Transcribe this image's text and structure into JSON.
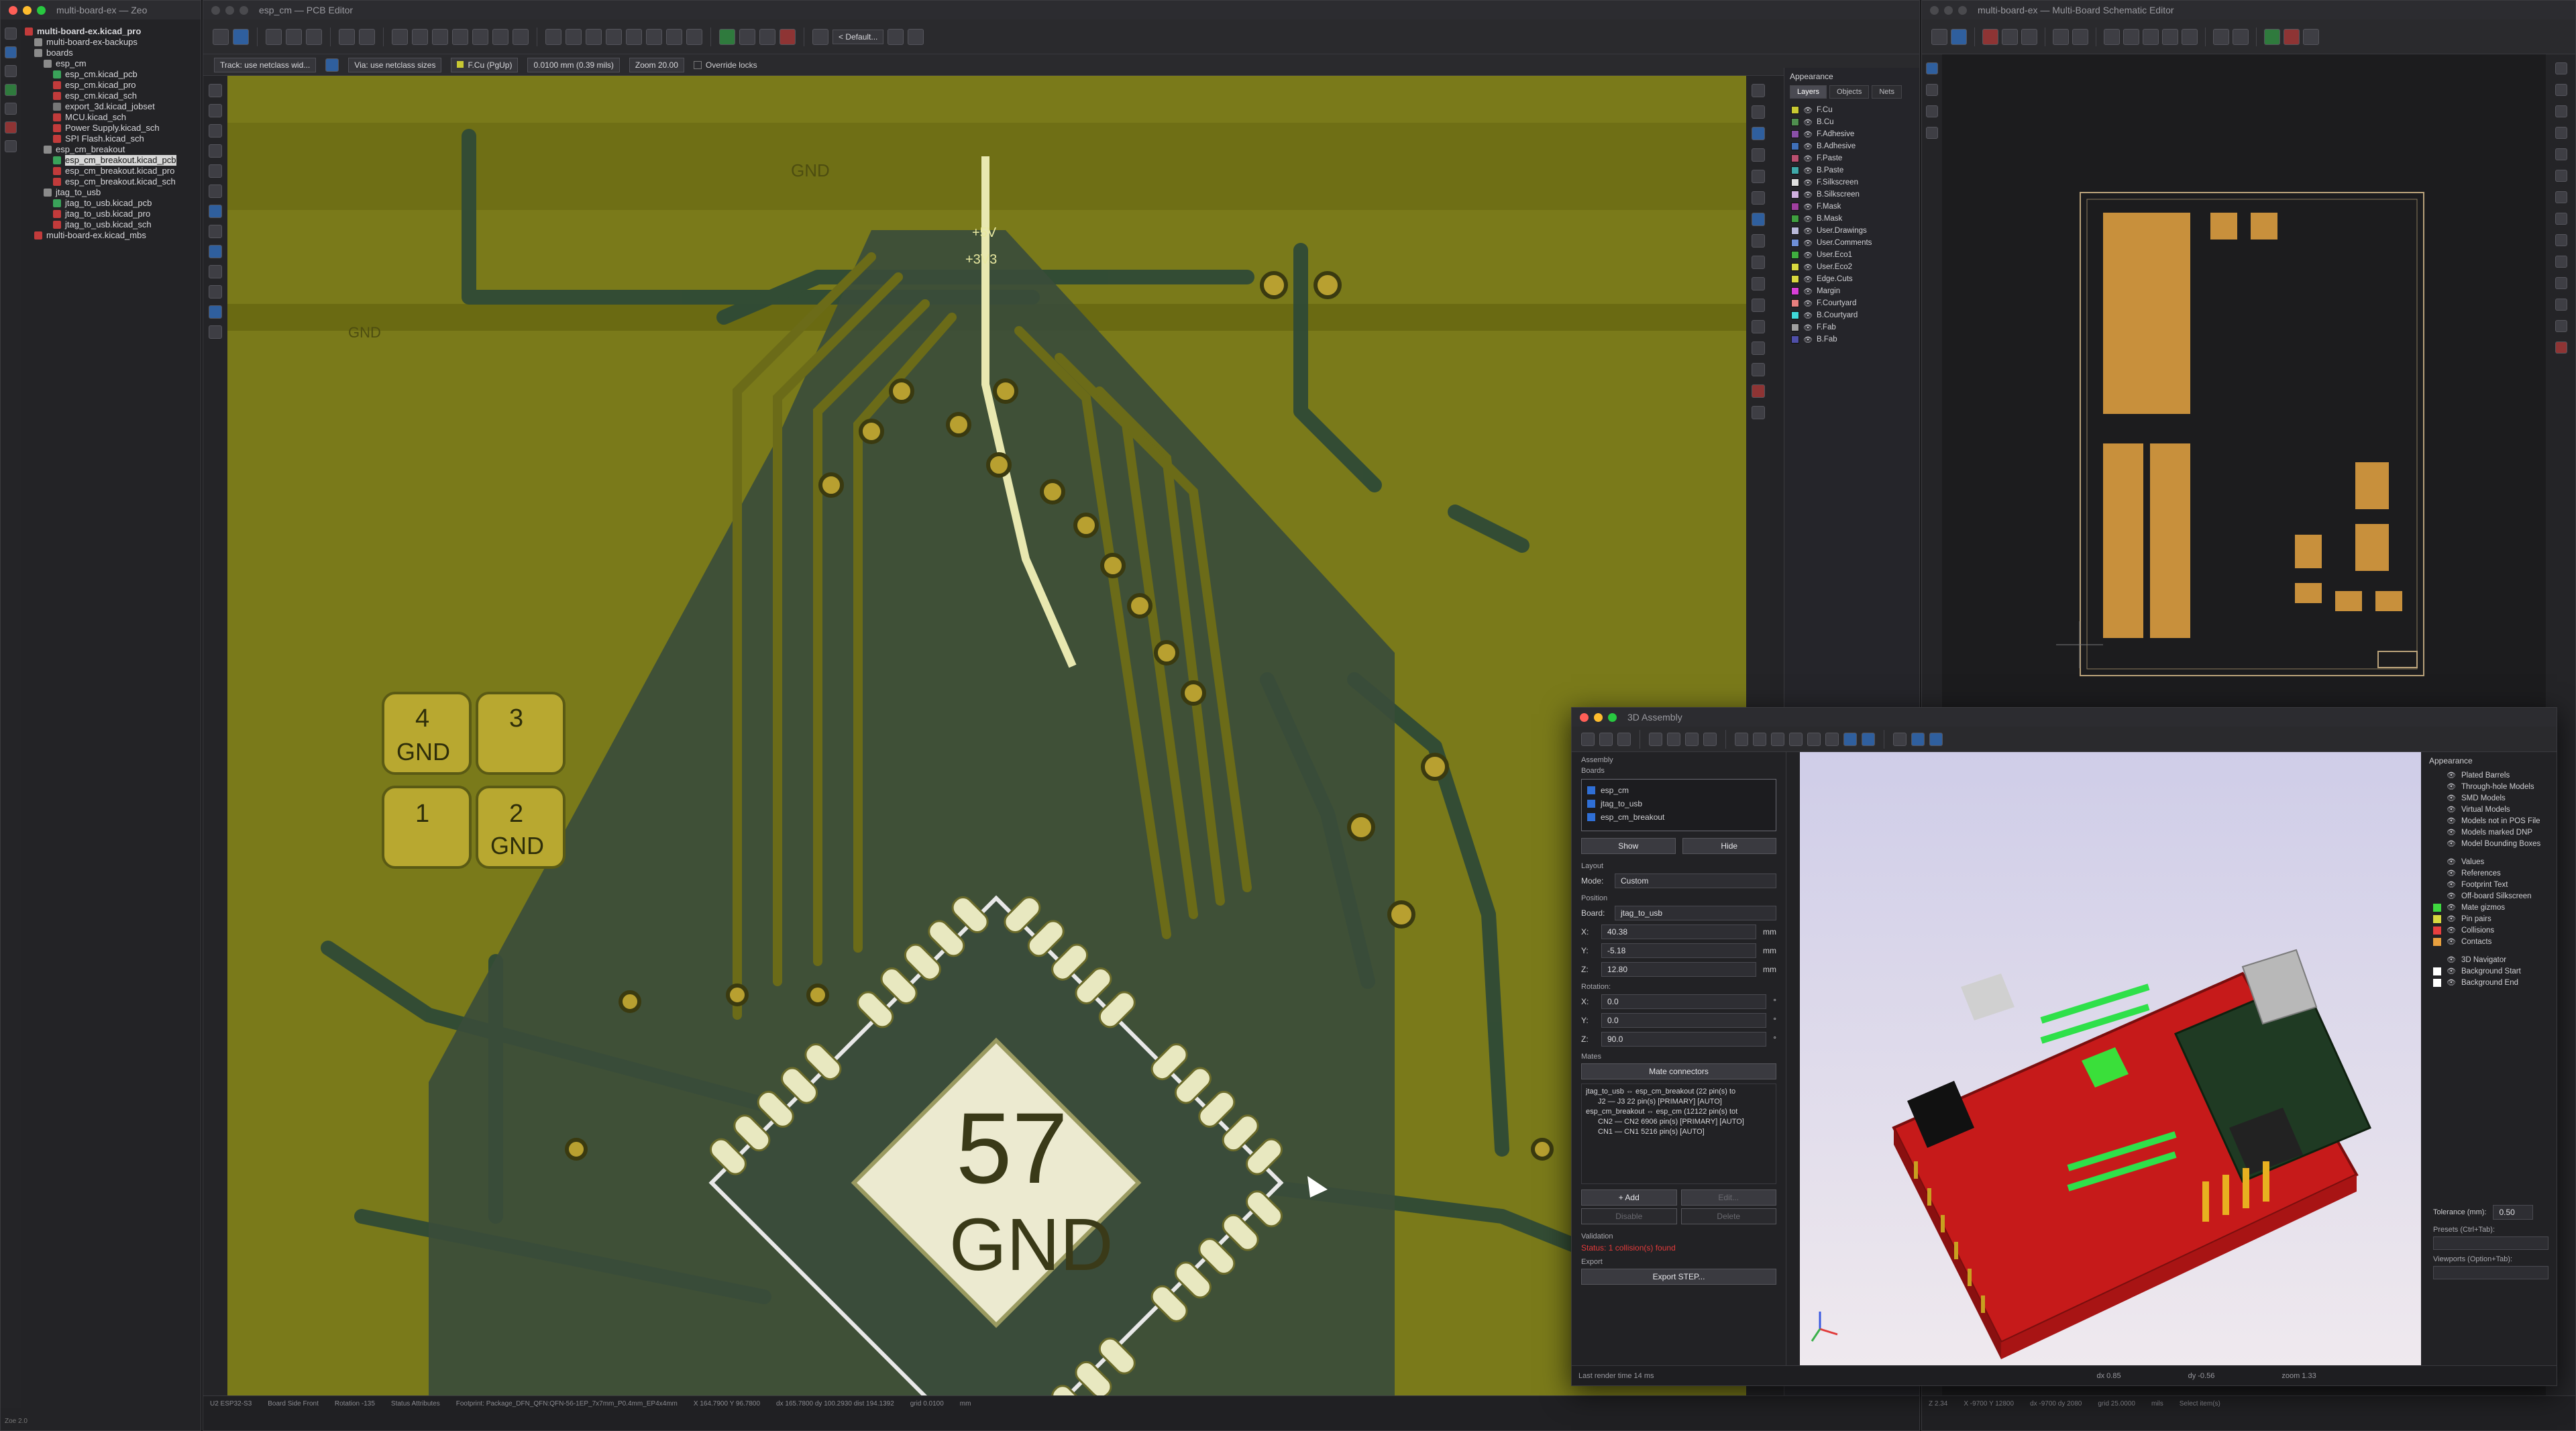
{
  "tree": {
    "title": "multi-board-ex — Zeo",
    "items": [
      {
        "label": "multi-board-ex.kicad_pro",
        "depth": 0,
        "color": "#c23b3b",
        "bold": true
      },
      {
        "label": "multi-board-ex-backups",
        "depth": 1,
        "color": "#8b8b8b"
      },
      {
        "label": "boards",
        "depth": 1,
        "color": "#8b8b8b"
      },
      {
        "label": "esp_cm",
        "depth": 2,
        "color": "#8b8b8b"
      },
      {
        "label": "esp_cm.kicad_pcb",
        "depth": 3,
        "color": "#3aa35a"
      },
      {
        "label": "esp_cm.kicad_pro",
        "depth": 3,
        "color": "#c23b3b"
      },
      {
        "label": "esp_cm.kicad_sch",
        "depth": 3,
        "color": "#c23b3b"
      },
      {
        "label": "export_3d.kicad_jobset",
        "depth": 3,
        "color": "#777777"
      },
      {
        "label": "MCU.kicad_sch",
        "depth": 3,
        "color": "#c23b3b"
      },
      {
        "label": "Power Supply.kicad_sch",
        "depth": 3,
        "color": "#c23b3b"
      },
      {
        "label": "SPI Flash.kicad_sch",
        "depth": 3,
        "color": "#c23b3b"
      },
      {
        "label": "esp_cm_breakout",
        "depth": 2,
        "color": "#8b8b8b"
      },
      {
        "label": "esp_cm_breakout.kicad_pcb",
        "depth": 3,
        "color": "#3aa35a",
        "selected": true
      },
      {
        "label": "esp_cm_breakout.kicad_pro",
        "depth": 3,
        "color": "#c23b3b"
      },
      {
        "label": "esp_cm_breakout.kicad_sch",
        "depth": 3,
        "color": "#c23b3b"
      },
      {
        "label": "jtag_to_usb",
        "depth": 2,
        "color": "#8b8b8b"
      },
      {
        "label": "jtag_to_usb.kicad_pcb",
        "depth": 3,
        "color": "#3aa35a"
      },
      {
        "label": "jtag_to_usb.kicad_pro",
        "depth": 3,
        "color": "#c23b3b"
      },
      {
        "label": "jtag_to_usb.kicad_sch",
        "depth": 3,
        "color": "#c23b3b"
      },
      {
        "label": "multi-board-ex.kicad_mbs",
        "depth": 1,
        "color": "#c23b3b"
      }
    ]
  },
  "pcb": {
    "title": "esp_cm — PCB Editor",
    "track": "Track: use netclass wid...",
    "via": "Via: use netclass sizes",
    "layer": "F.Cu (PgUp)",
    "grid": "0.0100 mm (0.39 mils)",
    "zoom": "Zoom 20.00",
    "override": "Override locks",
    "default": "< Default...",
    "labels": {
      "gnd_top": "GND",
      "plus5v": "+5V",
      "plus3v3": "+3V3",
      "gnd_left": "GND",
      "chip_num": "57",
      "chip_net": "GND",
      "pad4": "4",
      "pad3": "3",
      "pad1": "1",
      "pad2": "2",
      "pad_gnd": "GND"
    },
    "status": {
      "s1": "U2  ESP32-S3",
      "s2": "Board Side  Front",
      "s3": "Rotation  -135",
      "s4": "Status  Attributes",
      "s5": "Footprint: Package_DFN_QFN:QFN-56-1EP_7x7mm_P0.4mm_EP4x4mm",
      "s6": "X 164.7900  Y 96.7800",
      "s7": "dx 165.7800  dy 100.2930  dist 194.1392",
      "s8": "grid 0.0100",
      "s9": "mm"
    }
  },
  "appearance": {
    "title": "Appearance",
    "tabs": [
      "Layers",
      "Objects",
      "Nets"
    ],
    "layers": [
      {
        "name": "F.Cu",
        "color": "#c8c832"
      },
      {
        "name": "B.Cu",
        "color": "#4f8f4f"
      },
      {
        "name": "F.Adhesive",
        "color": "#8a4fa8"
      },
      {
        "name": "B.Adhesive",
        "color": "#3f6fb8"
      },
      {
        "name": "F.Paste",
        "color": "#b84f6f"
      },
      {
        "name": "B.Paste",
        "color": "#3fa8a8"
      },
      {
        "name": "F.Silkscreen",
        "color": "#e0e0e0"
      },
      {
        "name": "B.Silkscreen",
        "color": "#d0b0e0"
      },
      {
        "name": "F.Mask",
        "color": "#9f3f9f"
      },
      {
        "name": "B.Mask",
        "color": "#3f9f3f"
      },
      {
        "name": "User.Drawings",
        "color": "#b8b8d8"
      },
      {
        "name": "User.Comments",
        "color": "#6f8fd8"
      },
      {
        "name": "User.Eco1",
        "color": "#3faf3f"
      },
      {
        "name": "User.Eco2",
        "color": "#d8d83f"
      },
      {
        "name": "Edge.Cuts",
        "color": "#d8d83f"
      },
      {
        "name": "Margin",
        "color": "#d83fd8"
      },
      {
        "name": "F.Courtyard",
        "color": "#e87f7f"
      },
      {
        "name": "B.Courtyard",
        "color": "#3fd8d8"
      },
      {
        "name": "F.Fab",
        "color": "#9f9f9f"
      },
      {
        "name": "B.Fab",
        "color": "#4f4fa8"
      }
    ]
  },
  "schematic": {
    "title": "multi-board-ex — Multi-Board Schematic Editor",
    "status": {
      "s1": "Z 2.34",
      "s2": "X -9700  Y 12800",
      "s3": "dx -9700  dy 2080",
      "s4": "grid 25.0000",
      "s5": "mils",
      "s6": "Select item(s)"
    }
  },
  "assembly": {
    "title": "3D Assembly",
    "assembly_label": "Assembly",
    "boards_label": "Boards",
    "boards": [
      {
        "name": "esp_cm",
        "checked": true
      },
      {
        "name": "jtag_to_usb",
        "checked": true
      },
      {
        "name": "esp_cm_breakout",
        "checked": true
      }
    ],
    "show": "Show",
    "hide": "Hide",
    "layout_label": "Layout",
    "mode_label": "Mode:",
    "mode_value": "Custom",
    "position_label": "Position",
    "board_label": "Board:",
    "board_value": "jtag_to_usb",
    "x_label": "X:",
    "x_value": "40.38",
    "y_label": "Y:",
    "y_value": "-5.18",
    "z_label": "Z:",
    "z_value": "12.80",
    "unit": "mm",
    "rotation_label": "Rotation:",
    "rx_label": "X:",
    "rx_value": "0.0",
    "ry_label": "Y:",
    "ry_value": "0.0",
    "rz_label": "Z:",
    "rz_value": "90.0",
    "deg": "°",
    "mates_label": "Mates",
    "mate_button": "Mate connectors",
    "mates": [
      "jtag_to_usb ⇔ esp_cm_breakout  (22 pin(s) to",
      "J2 — J3  22 pin(s)  [PRIMARY] [AUTO]",
      "esp_cm_breakout ⇔ esp_cm  (12122 pin(s) tot",
      "CN2 — CN2  6906 pin(s)  [PRIMARY] [AUTO]",
      "CN1 — CN1  5216 pin(s)  [AUTO]"
    ],
    "add": "+ Add",
    "edit": "Edit...",
    "disable": "Disable",
    "delete": "Delete",
    "validation_label": "Validation",
    "validation_status": "Status: 1 collision(s) found",
    "export_label": "Export",
    "export_button": "Export STEP...",
    "render_time": "Last render time 14 ms",
    "dx": "dx 0.85",
    "dy": "dy -0.56",
    "zoom": "zoom 1.33",
    "appearance_title": "Appearance",
    "app_items": [
      {
        "label": "Plated Barrels",
        "color": ""
      },
      {
        "label": "Through-hole Models",
        "color": ""
      },
      {
        "label": "SMD Models",
        "color": ""
      },
      {
        "label": "Virtual Models",
        "color": ""
      },
      {
        "label": "Models not in POS File",
        "color": ""
      },
      {
        "label": "Models marked DNP",
        "color": ""
      },
      {
        "label": "Model Bounding Boxes",
        "color": ""
      },
      {
        "label": "Values",
        "color": ""
      },
      {
        "label": "References",
        "color": ""
      },
      {
        "label": "Footprint Text",
        "color": ""
      },
      {
        "label": "Off-board Silkscreen",
        "color": ""
      },
      {
        "label": "Mate gizmos",
        "color": "#3fd83f"
      },
      {
        "label": "Pin pairs",
        "color": "#d8d83f"
      },
      {
        "label": "Collisions",
        "color": "#e83f3f"
      },
      {
        "label": "Contacts",
        "color": "#e8a03f"
      },
      {
        "label": "3D Navigator",
        "color": ""
      },
      {
        "label": "Background Start",
        "color": "#ffffff"
      },
      {
        "label": "Background End",
        "color": "#ffffff"
      }
    ],
    "tolerance_label": "Tolerance (mm):",
    "tolerance_value": "0.50",
    "presets_label": "Presets (Ctrl+Tab):",
    "viewports_label": "Viewports (Option+Tab):"
  },
  "bottom_left": "Zoe 2.0"
}
